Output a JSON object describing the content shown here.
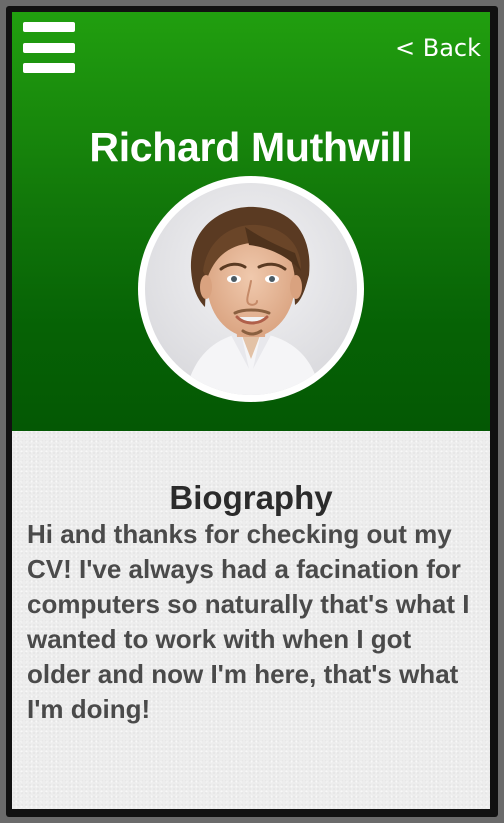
{
  "header": {
    "menu_icon": "hamburger-menu-icon",
    "back_label": "< Back",
    "name": "Richard Muthwill",
    "avatar_alt": "profile-photo"
  },
  "biography": {
    "title": "Biography",
    "text": "Hi and thanks for checking out my CV! I've always had a facination for computers so naturally that's what I wanted to work with when I got older and now I'm here, that's what I'm doing!"
  },
  "colors": {
    "header_top": "#219f0f",
    "header_bottom": "#045804",
    "text_light": "#ffffff",
    "title_text": "#2b2b2b",
    "body_text": "#4a4a4a",
    "content_bg": "#ededed"
  }
}
